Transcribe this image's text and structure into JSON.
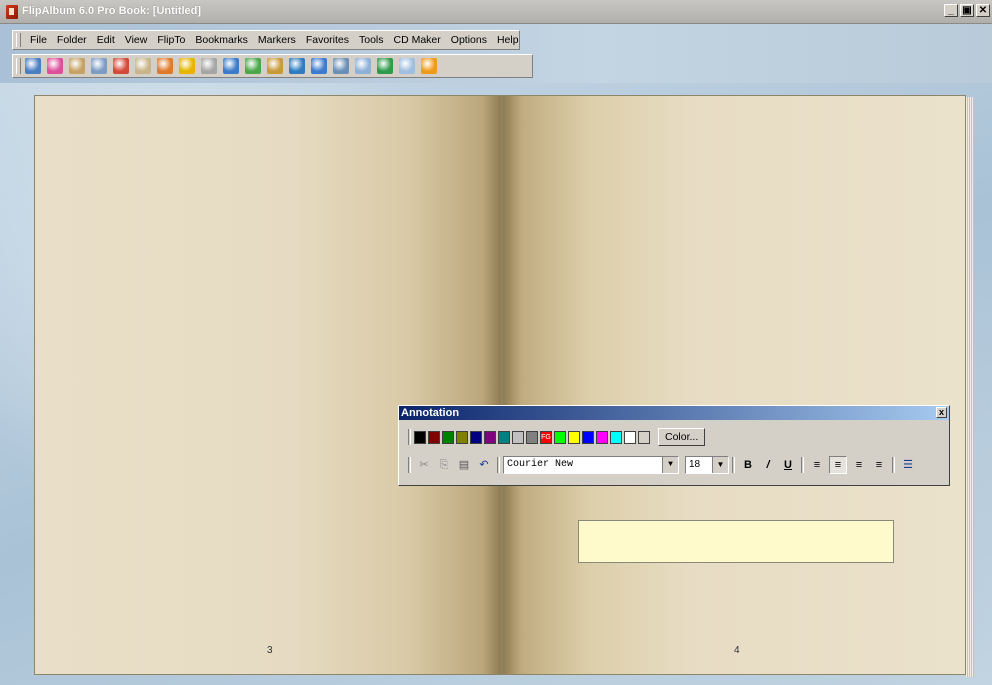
{
  "window": {
    "title": "FlipAlbum 6.0 Pro   Book: [Untitled]",
    "controls": [
      "_",
      "▣",
      "✕"
    ]
  },
  "menu": [
    {
      "label": "File"
    },
    {
      "label": "Folder"
    },
    {
      "label": "Edit"
    },
    {
      "label": "View"
    },
    {
      "label": "FlipTo"
    },
    {
      "label": "Bookmarks"
    },
    {
      "label": "Markers"
    },
    {
      "label": "Favorites"
    },
    {
      "label": "Tools"
    },
    {
      "label": "CD Maker"
    },
    {
      "label": "Options"
    },
    {
      "label": "Help"
    }
  ],
  "toolbar": {
    "icons": [
      {
        "name": "view-icon",
        "color": "#4a7fc1"
      },
      {
        "name": "bookmark-icon",
        "color": "#e04f9c"
      },
      {
        "name": "book-icon",
        "color": "#c7a265"
      },
      {
        "name": "page-icon",
        "color": "#7d9cc4"
      },
      {
        "name": "arrow-icon",
        "color": "#d24a3a"
      },
      {
        "name": "index-icon",
        "color": "#c9b58a"
      },
      {
        "name": "album-icon",
        "color": "#e07a2b"
      },
      {
        "name": "add-icon",
        "color": "#e8b400"
      },
      {
        "name": "edit-icon",
        "color": "#a6a6a6"
      },
      {
        "name": "columns-icon",
        "color": "#3a7cc9"
      },
      {
        "name": "tag-icon",
        "color": "#4aa84a"
      },
      {
        "name": "photo-icon",
        "color": "#c99a3a"
      },
      {
        "name": "cd-icon",
        "color": "#2f7bbf"
      },
      {
        "name": "music-icon",
        "color": "#3a7acf"
      },
      {
        "name": "film-icon",
        "color": "#6b8fb5"
      },
      {
        "name": "screen-icon",
        "color": "#8db1d8"
      },
      {
        "name": "globe-icon",
        "color": "#2f9a4a"
      },
      {
        "name": "pointer-icon",
        "color": "#9fbfe0"
      },
      {
        "name": "star-icon",
        "color": "#f09a1a"
      }
    ]
  },
  "book": {
    "left_page_number": "3",
    "right_page_number": "4"
  },
  "annotation": {
    "title": "Annotation",
    "close": "x",
    "swatches": [
      "#000000",
      "#800000",
      "#008000",
      "#808000",
      "#000080",
      "#800080",
      "#008080",
      "#c0c0c0",
      "#808080",
      "#ff0000",
      "#00ff00",
      "#ffff00",
      "#0000ff",
      "#ff00ff",
      "#00ffff",
      "#ffffff",
      "#d4d0c8"
    ],
    "fg_label": "FG",
    "color_button": "Color...",
    "font": "Courier New",
    "size": "18",
    "bold": "B",
    "italic": "/",
    "underline": "U"
  }
}
